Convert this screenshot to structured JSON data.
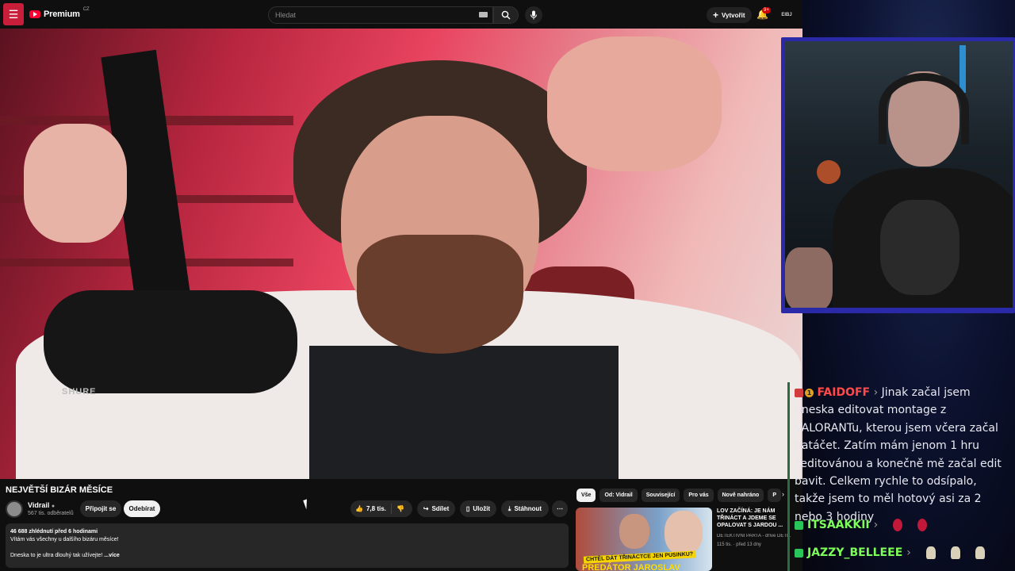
{
  "youtube": {
    "logo_text": "Premium",
    "logo_region": "CZ",
    "search_placeholder": "Hledat",
    "create_label": "Vytvořit",
    "notif_count": "9+",
    "account_label": "ElBJ"
  },
  "video": {
    "title": "NEJVĚTŠÍ BIZÁR MĚSÍCE",
    "mic_brand": "SHURE",
    "channel_name": "Vidrail",
    "channel_subs": "567 tis. odběratelů",
    "join_label": "Připojit se",
    "subscribe_label": "Odebírat",
    "likes": "7,8 tis.",
    "share_label": "Sdílet",
    "save_label": "Uložit",
    "download_label": "Stáhnout",
    "views": "46 688 zhlédnutí",
    "age": "před 6 hodinami",
    "desc_line1": "Vítám vás všechny u dalšího bizáru měsíce!",
    "desc_line2": "Dneska to je ultra dlouhý tak užívejte!",
    "desc_more": "...více"
  },
  "chips": [
    "Vše",
    "Od: Vidrail",
    "Související",
    "Pro vás",
    "Nově nahráno",
    "P"
  ],
  "recommended": {
    "title": "LOV ZAČÍNÁ: JE NÁM TŘINÁCT A JDEME SE OPALOVAT S JARDOU ...",
    "channel": "DETEKTIVNÍ PARTA - dříve DETE...",
    "meta": "115 tis. · před 13 dny",
    "thumb_caption": "CHTĚL DÁT TŘINÁCTCE JEN PUSINKU?",
    "thumb_caption2": "PREDÁTOR JAROSLAV PANĚK"
  },
  "chat": [
    {
      "user": "FAIDOFF",
      "text": "Jinak začal jsem dneska editovat montage z VALORANTu, kterou jsem včera začal natáčet. Zatím mám jenom 1 hru zeditovánou a konečně mě začal edit bavit. Celkem rychle to odsípalo, takže jsem to měl hotový asi za 2 nebo 3 hodiny",
      "color": "#ff4a4a"
    },
    {
      "user": "ITSAAKKII",
      "text": "",
      "color": "#7dff5a"
    },
    {
      "user": "JAZZY_BELLEEE",
      "text": "",
      "color": "#7dff5a"
    }
  ],
  "colors": {
    "accent": "#ff0033",
    "subscribe_bg": "#f1f1f1",
    "cam_border": "#2a2aa8"
  }
}
